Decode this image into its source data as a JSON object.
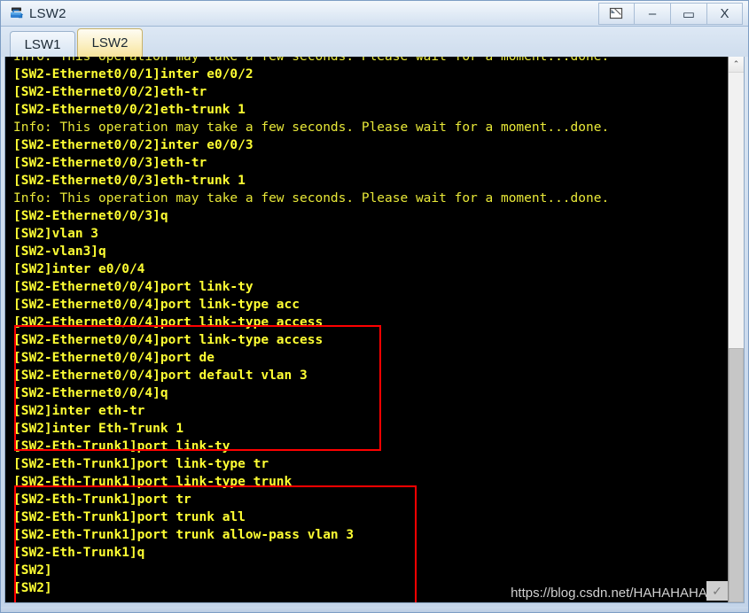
{
  "window": {
    "title": "LSW2",
    "icon": "switch-icon",
    "controls": [
      {
        "name": "restore-window-button",
        "glyph": "❐"
      },
      {
        "name": "minimize-window-button",
        "glyph": "–"
      },
      {
        "name": "maximize-window-button",
        "glyph": "▭"
      },
      {
        "name": "close-window-button",
        "glyph": "X"
      }
    ]
  },
  "tabs": [
    {
      "label": "LSW1",
      "active": false
    },
    {
      "label": "LSW2",
      "active": true
    }
  ],
  "terminal": {
    "foreground_color": "#ffff33",
    "background_color": "#000000",
    "lines": [
      {
        "text": "Info: This operation may take a few seconds. Please wait for a moment...done.",
        "style": "info"
      },
      {
        "text": "[SW2-Ethernet0/0/1]inter e0/0/2",
        "style": "prompt"
      },
      {
        "text": "[SW2-Ethernet0/0/2]eth-tr",
        "style": "prompt"
      },
      {
        "text": "[SW2-Ethernet0/0/2]eth-trunk 1",
        "style": "prompt"
      },
      {
        "text": "Info: This operation may take a few seconds. Please wait for a moment...done.",
        "style": "info"
      },
      {
        "text": "[SW2-Ethernet0/0/2]inter e0/0/3",
        "style": "prompt"
      },
      {
        "text": "[SW2-Ethernet0/0/3]eth-tr",
        "style": "prompt"
      },
      {
        "text": "[SW2-Ethernet0/0/3]eth-trunk 1",
        "style": "prompt"
      },
      {
        "text": "Info: This operation may take a few seconds. Please wait for a moment...done.",
        "style": "info"
      },
      {
        "text": "[SW2-Ethernet0/0/3]q",
        "style": "prompt"
      },
      {
        "text": "[SW2]vlan 3",
        "style": "prompt"
      },
      {
        "text": "[SW2-vlan3]q",
        "style": "prompt"
      },
      {
        "text": "[SW2]inter e0/0/4",
        "style": "prompt"
      },
      {
        "text": "[SW2-Ethernet0/0/4]port link-ty",
        "style": "prompt"
      },
      {
        "text": "[SW2-Ethernet0/0/4]port link-type acc",
        "style": "prompt"
      },
      {
        "text": "[SW2-Ethernet0/0/4]port link-type access",
        "style": "prompt"
      },
      {
        "text": "[SW2-Ethernet0/0/4]port link-type access",
        "style": "prompt"
      },
      {
        "text": "[SW2-Ethernet0/0/4]port de",
        "style": "prompt"
      },
      {
        "text": "[SW2-Ethernet0/0/4]port default vlan 3",
        "style": "prompt"
      },
      {
        "text": "[SW2-Ethernet0/0/4]q",
        "style": "prompt"
      },
      {
        "text": "[SW2]inter eth-tr",
        "style": "prompt"
      },
      {
        "text": "[SW2]inter Eth-Trunk 1",
        "style": "prompt"
      },
      {
        "text": "[SW2-Eth-Trunk1]port link-ty",
        "style": "prompt"
      },
      {
        "text": "[SW2-Eth-Trunk1]port link-type tr",
        "style": "prompt"
      },
      {
        "text": "[SW2-Eth-Trunk1]port link-type trunk",
        "style": "prompt"
      },
      {
        "text": "[SW2-Eth-Trunk1]port tr",
        "style": "prompt"
      },
      {
        "text": "[SW2-Eth-Trunk1]port trunk all",
        "style": "prompt"
      },
      {
        "text": "[SW2-Eth-Trunk1]port trunk allow-pass vlan 3",
        "style": "prompt"
      },
      {
        "text": "[SW2-Eth-Trunk1]q",
        "style": "prompt"
      },
      {
        "text": "[SW2]",
        "style": "prompt"
      },
      {
        "text": "[SW2]",
        "style": "prompt"
      }
    ]
  },
  "annotations": {
    "color": "#ff0000",
    "boxes": [
      {
        "name": "highlight-box-access-port",
        "first_line": 12,
        "last_line": 18
      },
      {
        "name": "highlight-box-trunk-port",
        "first_line": 21,
        "last_line": 27
      }
    ]
  },
  "watermark": {
    "text": "https://blog.csdn.net/HAHAHAHAZ",
    "badge_glyph": "✓",
    "color": "#d0d0d0"
  },
  "scrollbar": {
    "up_arrow_glyph": "⌃",
    "thumb_position": "lower"
  }
}
